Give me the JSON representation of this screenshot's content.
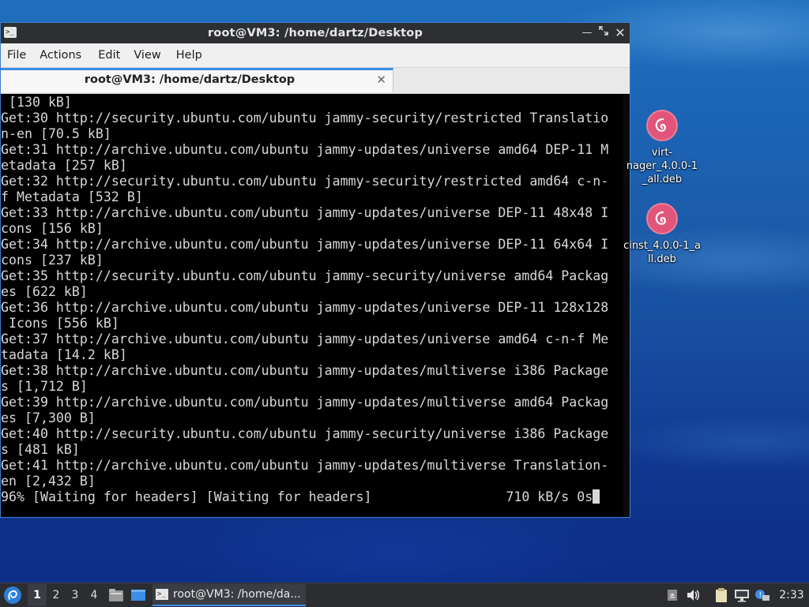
{
  "window": {
    "title": "root@VM3: /home/dartz/Desktop",
    "icon": "terminal-icon",
    "controls": [
      "minimize-icon",
      "maximize-icon",
      "close-icon"
    ]
  },
  "menubar": {
    "items": [
      "File",
      "Actions",
      "Edit",
      "View",
      "Help"
    ]
  },
  "tab": {
    "label": "root@VM3: /home/dartz/Desktop"
  },
  "terminal": {
    "lines": [
      " [130 kB]",
      "Get:30 http://security.ubuntu.com/ubuntu jammy-security/restricted Translatio",
      "n-en [70.5 kB]",
      "Get:31 http://archive.ubuntu.com/ubuntu jammy-updates/universe amd64 DEP-11 M",
      "etadata [257 kB]",
      "Get:32 http://security.ubuntu.com/ubuntu jammy-security/restricted amd64 c-n-",
      "f Metadata [532 B]",
      "Get:33 http://archive.ubuntu.com/ubuntu jammy-updates/universe DEP-11 48x48 I",
      "cons [156 kB]",
      "Get:34 http://archive.ubuntu.com/ubuntu jammy-updates/universe DEP-11 64x64 I",
      "cons [237 kB]",
      "Get:35 http://security.ubuntu.com/ubuntu jammy-security/universe amd64 Packag",
      "es [622 kB]",
      "Get:36 http://archive.ubuntu.com/ubuntu jammy-updates/universe DEP-11 128x128",
      " Icons [556 kB]",
      "Get:37 http://archive.ubuntu.com/ubuntu jammy-updates/universe amd64 c-n-f Me",
      "tadata [14.2 kB]",
      "Get:38 http://archive.ubuntu.com/ubuntu jammy-updates/multiverse i386 Package",
      "s [1,712 B]",
      "Get:39 http://archive.ubuntu.com/ubuntu jammy-updates/multiverse amd64 Packag",
      "es [7,300 B]",
      "Get:40 http://security.ubuntu.com/ubuntu jammy-security/universe i386 Package",
      "s [481 kB]",
      "Get:41 http://archive.ubuntu.com/ubuntu jammy-updates/multiverse Translation-",
      "en [2,432 B]"
    ],
    "progress_line": "96% [Waiting for headers] [Waiting for headers]                 710 kB/s 0s"
  },
  "desktop_icons": [
    {
      "label": "virt-\nnager_4.0.0-1\n_all.deb",
      "icon": "debian-package-icon"
    },
    {
      "label": "cinst_4.0.0-1_a\nll.deb",
      "icon": "debian-package-icon"
    }
  ],
  "taskbar": {
    "start_icon": "lxqt-start-icon",
    "workspaces": [
      "1",
      "2",
      "3",
      "4"
    ],
    "active_workspace": "1",
    "task_label": "root@VM3: /home/da...",
    "clock": "2:33",
    "tray_icons": [
      "eject-icon",
      "volume-icon",
      "clipboard-icon",
      "network-icon",
      "notification-icon"
    ]
  },
  "colors": {
    "accent": "#3d8ee6",
    "terminal_bg": "#000000",
    "terminal_fg": "#d8d8d8",
    "deb_logo": "#e2557a"
  }
}
